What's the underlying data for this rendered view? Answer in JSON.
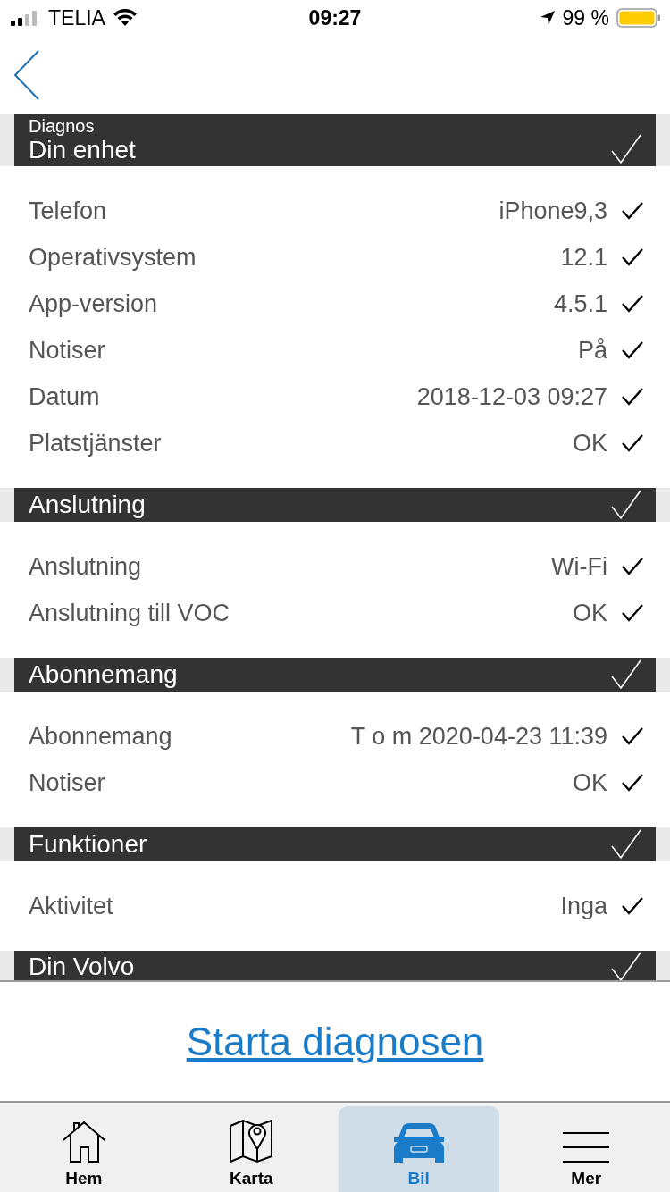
{
  "status_bar": {
    "carrier": "TELIA",
    "time": "09:27",
    "battery": "99 %"
  },
  "sections": [
    {
      "overline": "Diagnos",
      "title": "Din enhet",
      "checked": true,
      "rows": [
        {
          "label": "Telefon",
          "value": "iPhone9,3",
          "checked": true
        },
        {
          "label": "Operativsystem",
          "value": "12.1",
          "checked": true
        },
        {
          "label": "App-version",
          "value": "4.5.1",
          "checked": true
        },
        {
          "label": "Notiser",
          "value": "På",
          "checked": true
        },
        {
          "label": "Datum",
          "value": "2018-12-03 09:27",
          "checked": true
        },
        {
          "label": "Platstjänster",
          "value": "OK",
          "checked": true
        }
      ]
    },
    {
      "title": "Anslutning",
      "checked": true,
      "rows": [
        {
          "label": "Anslutning",
          "value": "Wi-Fi",
          "checked": true
        },
        {
          "label": "Anslutning till VOC",
          "value": "OK",
          "checked": true
        }
      ]
    },
    {
      "title": "Abonnemang",
      "checked": true,
      "rows": [
        {
          "label": "Abonnemang",
          "value": "T o m 2020-04-23 11:39",
          "checked": true
        },
        {
          "label": "Notiser",
          "value": "OK",
          "checked": true
        }
      ]
    },
    {
      "title": "Funktioner",
      "checked": true,
      "rows": [
        {
          "label": "Aktivitet",
          "value": "Inga",
          "checked": true
        }
      ]
    },
    {
      "title": "Din Volvo",
      "checked": true
    }
  ],
  "action": "Starta diagnosen",
  "tabs": [
    {
      "label": "Hem",
      "kind": "home",
      "selected": false
    },
    {
      "label": "Karta",
      "kind": "map",
      "selected": false
    },
    {
      "label": "Bil",
      "kind": "car",
      "selected": true
    },
    {
      "label": "Mer",
      "kind": "menu",
      "selected": false
    }
  ]
}
